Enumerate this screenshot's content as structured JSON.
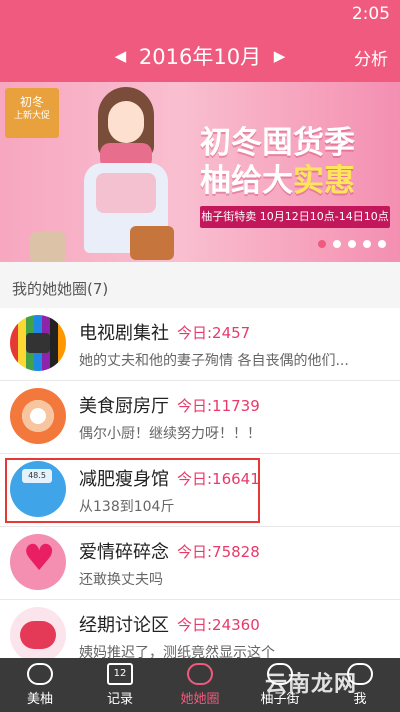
{
  "status": {
    "time": "2:05"
  },
  "header": {
    "prev_icon": "triangle-left-icon",
    "month": "2016年10月",
    "next_icon": "triangle-right-icon",
    "analyze_label": "分析"
  },
  "banner": {
    "badge_top": "初冬",
    "badge_bottom": "上新大促",
    "title_line1": "初冬囤货季",
    "title_line2_main": "柚给大",
    "title_line2_accent": "实惠",
    "subtitle": "柚子街特卖 10月12日10点-14日10点",
    "slide_count": 5,
    "active_slide": 1
  },
  "section": {
    "title": "我的她她圈(7)"
  },
  "groups": [
    {
      "name": "电视剧集社",
      "today": "今日:2457",
      "desc": "她的丈夫和他的妻子殉情 各自丧偶的他们..."
    },
    {
      "name": "美食厨房厅",
      "today": "今日:11739",
      "desc": "偶尔小厨！继续努力呀！！！"
    },
    {
      "name": "减肥瘦身馆",
      "today": "今日:16641",
      "desc": "从138到104斤",
      "scale_text": "48.5"
    },
    {
      "name": "爱情碎碎念",
      "today": "今日:75828",
      "desc": "还敢换丈夫吗"
    },
    {
      "name": "经期讨论区",
      "today": "今日:24360",
      "desc": "姨妈推迟了，测纸竟然显示这个"
    }
  ],
  "tabs": [
    {
      "label": "美柚",
      "icon": "meiyou-icon"
    },
    {
      "label": "记录",
      "icon": "calendar-icon",
      "icon_text": "12"
    },
    {
      "label": "她她圈",
      "icon": "circle-icon"
    },
    {
      "label": "柚子街",
      "icon": "shop-icon"
    },
    {
      "label": "我",
      "icon": "profile-icon"
    }
  ],
  "active_tab": 2,
  "watermark": "云南龙网",
  "colors": {
    "primary": "#f05a7e",
    "today_text": "#e8396a",
    "highlight_border": "#e53935",
    "tab_bg": "#3a3a3a"
  }
}
